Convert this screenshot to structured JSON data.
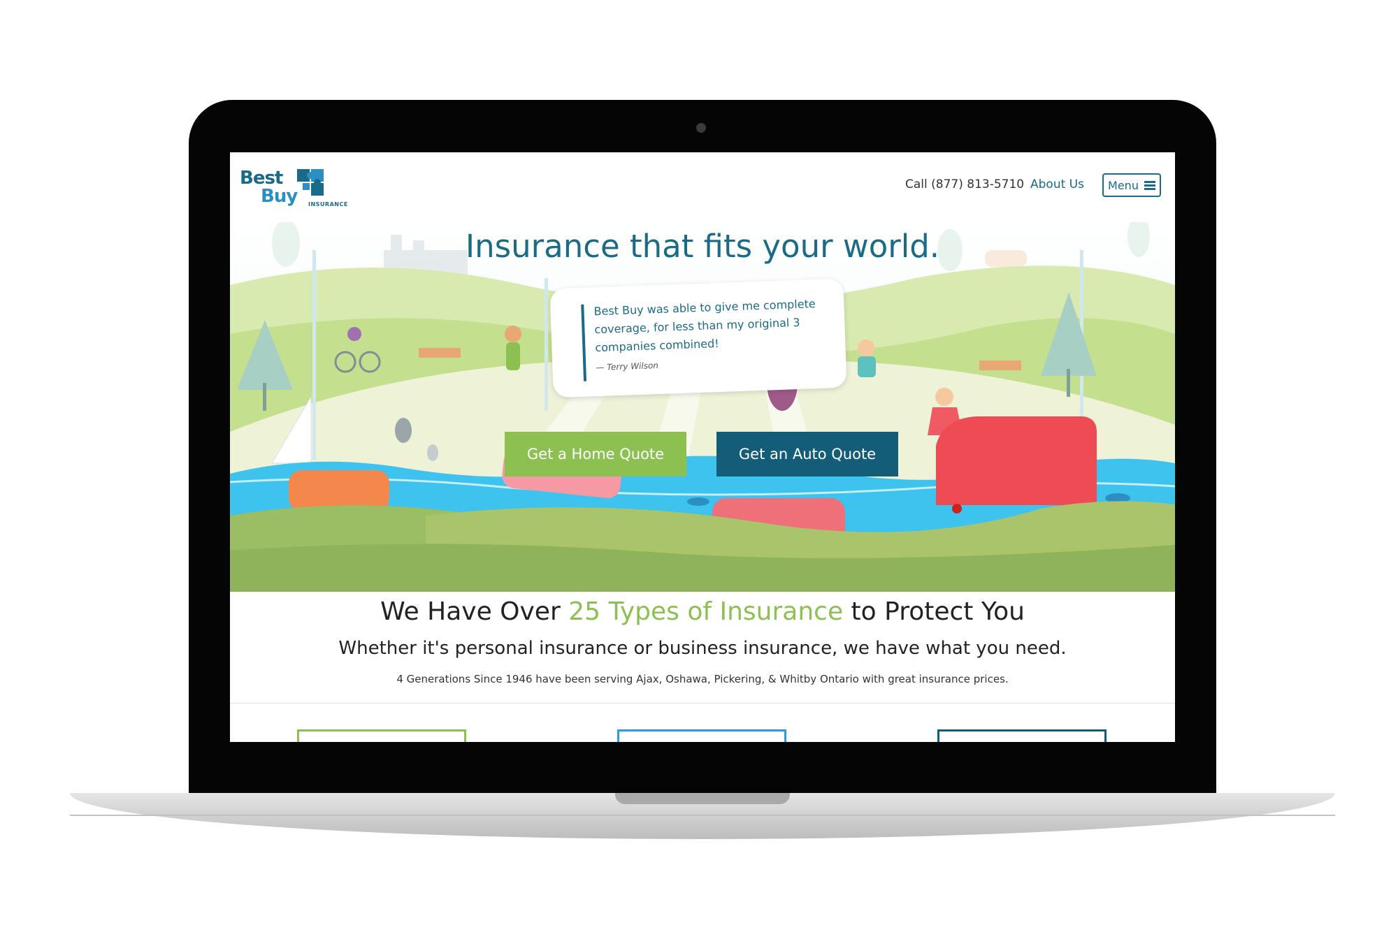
{
  "header": {
    "logo": {
      "line1": "Best",
      "line2": "Buy",
      "tagline": "INSURANCE"
    },
    "phone": "Call (877) 813-5710",
    "about": "About Us",
    "menu": "Menu"
  },
  "hero": {
    "title": "Insurance that fits your world.",
    "testimonial": {
      "quote": "Best Buy was able to give me complete coverage, for less than my original 3 companies combined!",
      "author": "— Terry Wilson"
    },
    "buttons": {
      "home": "Get a Home Quote",
      "auto": "Get an Auto Quote"
    }
  },
  "content": {
    "title_pre": "We Have Over ",
    "title_accent": "25 Types of Insurance",
    "title_post": " to Protect You",
    "subtitle": "Whether it's personal insurance or business insurance, we have what you need.",
    "note": "4 Generations Since 1946 have been serving Ajax, Oshawa, Pickering, & Whitby Ontario with great insurance prices."
  },
  "colors": {
    "brand_blue": "#1b6b87",
    "brand_green": "#8cc152",
    "dark_teal": "#135d78",
    "river": "#3ec3ef",
    "grass": "#a9c46a"
  },
  "icons": [
    "menu-icon",
    "camera-icon"
  ]
}
